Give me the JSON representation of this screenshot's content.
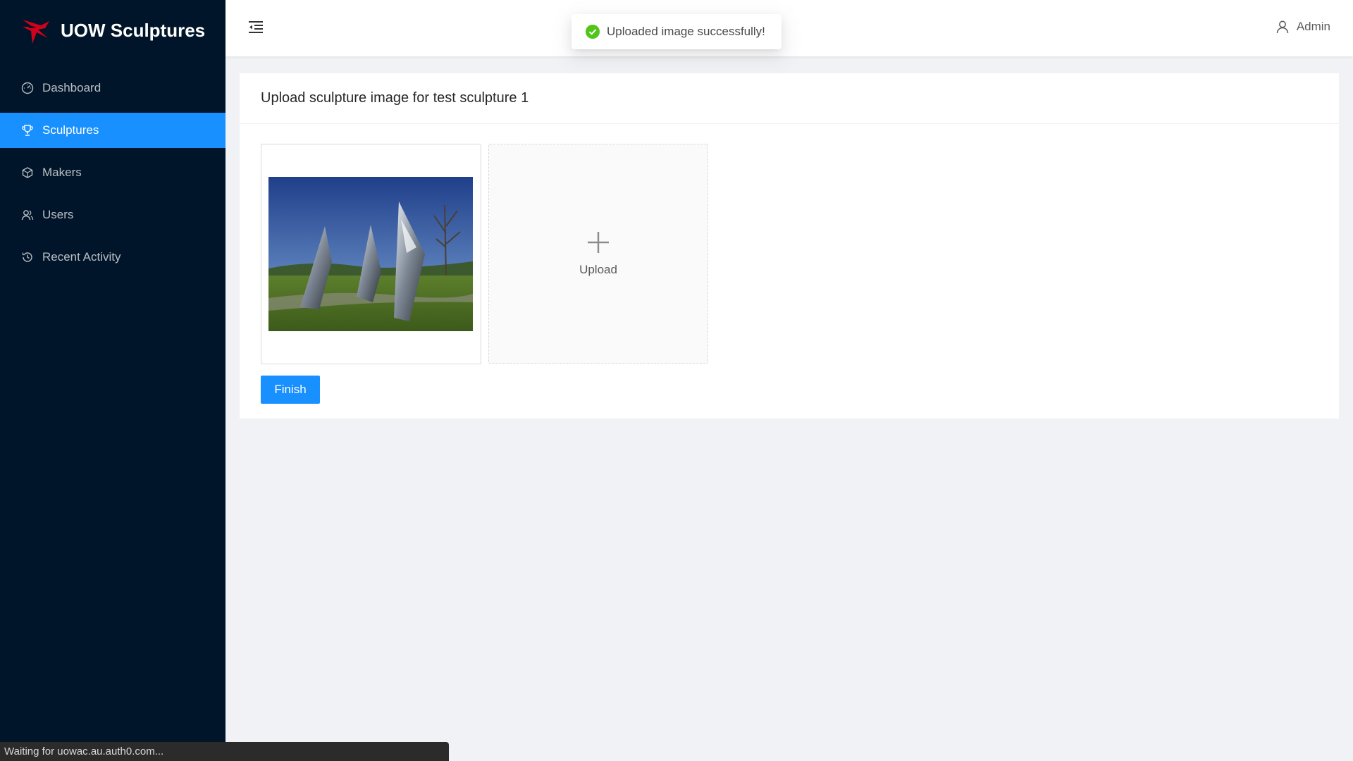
{
  "app": {
    "title": "UOW Sculptures",
    "accent": "#1890ff",
    "sidebar_bg": "#001529"
  },
  "sidebar": {
    "items": [
      {
        "label": "Dashboard",
        "icon": "dashboard-icon",
        "active": false
      },
      {
        "label": "Sculptures",
        "icon": "trophy-icon",
        "active": true
      },
      {
        "label": "Makers",
        "icon": "cube-icon",
        "active": false
      },
      {
        "label": "Users",
        "icon": "user-group-icon",
        "active": false
      },
      {
        "label": "Recent Activity",
        "icon": "history-icon",
        "active": false
      }
    ]
  },
  "header": {
    "collapse_icon": "menu-fold-icon",
    "user_label": "Admin",
    "user_icon": "user-icon"
  },
  "toast": {
    "message": "Uploaded image successfully!",
    "icon": "check-circle-icon",
    "color": "#52c41a"
  },
  "card": {
    "title": "Upload sculpture image for test sculpture 1",
    "upload_label": "Upload",
    "finish_label": "Finish"
  },
  "statusbar": {
    "text": "Waiting for uowac.au.auth0.com..."
  }
}
